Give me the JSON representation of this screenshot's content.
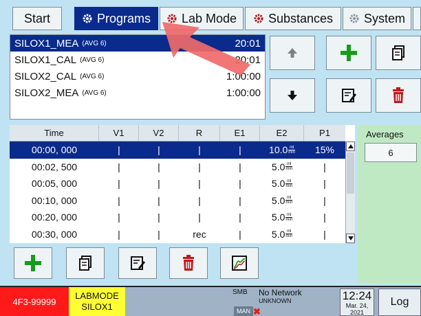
{
  "tabs": [
    {
      "label": "Start",
      "icon": ""
    },
    {
      "label": "Programs",
      "icon": "gear-icon"
    },
    {
      "label": "Lab Mode",
      "icon": "gear-icon"
    },
    {
      "label": "Substances",
      "icon": "gear-icon"
    },
    {
      "label": "System",
      "icon": "gear-icon"
    }
  ],
  "programs": [
    {
      "name": "SILOX1_MEA",
      "avg": "(AVG 6)",
      "duration": "20:01",
      "selected": true
    },
    {
      "name": "SILOX1_CAL",
      "avg": "(AVG 6)",
      "duration": "20:01",
      "selected": false
    },
    {
      "name": "SILOX2_CAL",
      "avg": "(AVG 6)",
      "duration": "1:00:00",
      "selected": false
    },
    {
      "name": "SILOX2_MEA",
      "avg": "(AVG 6)",
      "duration": "1:00:00",
      "selected": false
    }
  ],
  "table": {
    "headers": [
      "Time",
      "V1",
      "V2",
      "R",
      "E1",
      "E2",
      "P1"
    ],
    "unit_num": "ml",
    "unit_den": "min",
    "rows": [
      {
        "time": "00:00, 000",
        "v1": "|",
        "v2": "|",
        "r": "|",
        "e1": "|",
        "e2": "10.0",
        "p1": "15%",
        "selected": true
      },
      {
        "time": "00:02, 500",
        "v1": "|",
        "v2": "|",
        "r": "|",
        "e1": "|",
        "e2": "5.0",
        "p1": "|",
        "selected": false
      },
      {
        "time": "00:05, 000",
        "v1": "|",
        "v2": "|",
        "r": "|",
        "e1": "|",
        "e2": "5.0",
        "p1": "|",
        "selected": false
      },
      {
        "time": "00:10, 000",
        "v1": "|",
        "v2": "|",
        "r": "|",
        "e1": "|",
        "e2": "5.0",
        "p1": "|",
        "selected": false
      },
      {
        "time": "00:20, 000",
        "v1": "|",
        "v2": "|",
        "r": "|",
        "e1": "|",
        "e2": "5.0",
        "p1": "|",
        "selected": false
      },
      {
        "time": "00:30, 000",
        "v1": "|",
        "v2": "|",
        "r": "rec",
        "e1": "|",
        "e2": "5.0",
        "p1": "|",
        "selected": false
      }
    ]
  },
  "averages": {
    "label": "Averages",
    "value": "6"
  },
  "status": {
    "device": "4F3-99999",
    "mode_line1": "LABMODE",
    "mode_line2": "SILOX1",
    "smb": "SMB",
    "man": "MAN",
    "network": "No Network",
    "network_sub": "UNKNOWN",
    "time": "12:24",
    "date_line1": "Mar. 24,",
    "date_line2": "2021",
    "log_label": "Log"
  },
  "colors": {
    "selection": "#0a2a8c",
    "accent_green": "#1a9a1a",
    "accent_red": "#c01818",
    "device_red": "#ff1a1a",
    "mode_yellow": "#ffff33",
    "arrow": "#f06a6a"
  }
}
